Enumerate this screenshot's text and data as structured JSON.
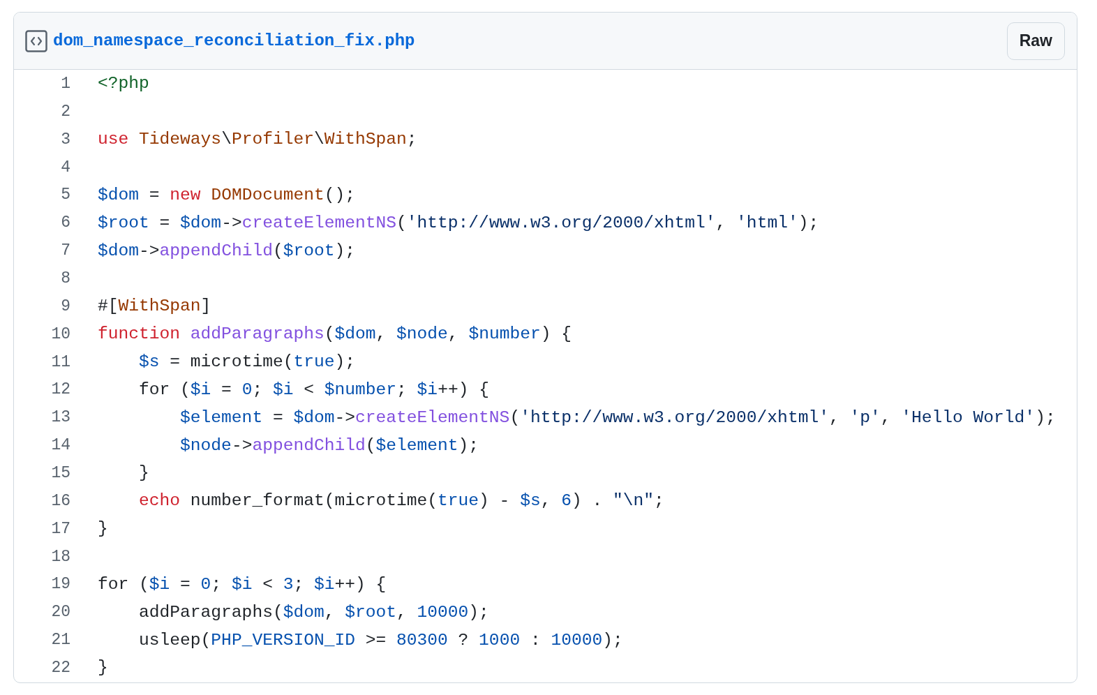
{
  "file": {
    "name": "dom_namespace_reconciliation_fix.php",
    "raw_button": "Raw"
  },
  "lines": [
    {
      "number": "1",
      "tokens": [
        {
          "kind": "meta",
          "text": "<?php"
        }
      ]
    },
    {
      "number": "2"
    },
    {
      "number": "3",
      "tokens": [
        {
          "kind": "keyword",
          "text": "use "
        },
        {
          "kind": "entity",
          "text": "Tideways"
        },
        {
          "kind": "plain",
          "text": "\\"
        },
        {
          "kind": "entity",
          "text": "Profiler"
        },
        {
          "kind": "plain",
          "text": "\\"
        },
        {
          "kind": "entity",
          "text": "WithSpan"
        },
        {
          "kind": "plain",
          "text": ";"
        }
      ]
    },
    {
      "number": "4"
    },
    {
      "number": "5",
      "tokens": [
        {
          "kind": "variable",
          "text": "$dom"
        },
        {
          "kind": "plain",
          "text": " = "
        },
        {
          "kind": "keyword",
          "text": "new "
        },
        {
          "kind": "entity",
          "text": "DOMDocument"
        },
        {
          "kind": "plain",
          "text": "();"
        }
      ]
    },
    {
      "number": "6",
      "tokens": [
        {
          "kind": "variable",
          "text": "$root"
        },
        {
          "kind": "plain",
          "text": " = "
        },
        {
          "kind": "variable",
          "text": "$dom"
        },
        {
          "kind": "plain",
          "text": "->"
        },
        {
          "kind": "function",
          "text": "createElementNS"
        },
        {
          "kind": "plain",
          "text": "("
        },
        {
          "kind": "string",
          "text": "'http://www.w3.org/2000/xhtml'"
        },
        {
          "kind": "plain",
          "text": ", "
        },
        {
          "kind": "string",
          "text": "'html'"
        },
        {
          "kind": "plain",
          "text": ");"
        }
      ]
    },
    {
      "number": "7",
      "tokens": [
        {
          "kind": "variable",
          "text": "$dom"
        },
        {
          "kind": "plain",
          "text": "->"
        },
        {
          "kind": "function",
          "text": "appendChild"
        },
        {
          "kind": "plain",
          "text": "("
        },
        {
          "kind": "variable",
          "text": "$root"
        },
        {
          "kind": "plain",
          "text": ");"
        }
      ]
    },
    {
      "number": "8"
    },
    {
      "number": "9",
      "tokens": [
        {
          "kind": "plain",
          "text": "#["
        },
        {
          "kind": "entity",
          "text": "WithSpan"
        },
        {
          "kind": "plain",
          "text": "]"
        }
      ]
    },
    {
      "number": "10",
      "tokens": [
        {
          "kind": "keyword",
          "text": "function "
        },
        {
          "kind": "function",
          "text": "addParagraphs"
        },
        {
          "kind": "plain",
          "text": "("
        },
        {
          "kind": "variable",
          "text": "$dom"
        },
        {
          "kind": "plain",
          "text": ", "
        },
        {
          "kind": "variable",
          "text": "$node"
        },
        {
          "kind": "plain",
          "text": ", "
        },
        {
          "kind": "variable",
          "text": "$number"
        },
        {
          "kind": "plain",
          "text": ") {"
        }
      ]
    },
    {
      "number": "11",
      "tokens": [
        {
          "kind": "variable",
          "text": "    $s"
        },
        {
          "kind": "plain",
          "text": " = microtime("
        },
        {
          "kind": "constant",
          "text": "true"
        },
        {
          "kind": "plain",
          "text": ");"
        }
      ]
    },
    {
      "number": "12",
      "tokens": [
        {
          "kind": "plain",
          "text": "    for ("
        },
        {
          "kind": "variable",
          "text": "$i"
        },
        {
          "kind": "plain",
          "text": " = "
        },
        {
          "kind": "constant",
          "text": "0"
        },
        {
          "kind": "plain",
          "text": "; "
        },
        {
          "kind": "variable",
          "text": "$i"
        },
        {
          "kind": "plain",
          "text": " < "
        },
        {
          "kind": "variable",
          "text": "$number"
        },
        {
          "kind": "plain",
          "text": "; "
        },
        {
          "kind": "variable",
          "text": "$i"
        },
        {
          "kind": "plain",
          "text": "++) {"
        }
      ]
    },
    {
      "number": "13",
      "tokens": [
        {
          "kind": "variable",
          "text": "        $element"
        },
        {
          "kind": "plain",
          "text": " = "
        },
        {
          "kind": "variable",
          "text": "$dom"
        },
        {
          "kind": "plain",
          "text": "->"
        },
        {
          "kind": "function",
          "text": "createElementNS"
        },
        {
          "kind": "plain",
          "text": "("
        },
        {
          "kind": "string",
          "text": "'http://www.w3.org/2000/xhtml'"
        },
        {
          "kind": "plain",
          "text": ", "
        },
        {
          "kind": "string",
          "text": "'p'"
        },
        {
          "kind": "plain",
          "text": ", "
        },
        {
          "kind": "string",
          "text": "'Hello World'"
        },
        {
          "kind": "plain",
          "text": ");"
        }
      ]
    },
    {
      "number": "14",
      "tokens": [
        {
          "kind": "variable",
          "text": "        $node"
        },
        {
          "kind": "plain",
          "text": "->"
        },
        {
          "kind": "function",
          "text": "appendChild"
        },
        {
          "kind": "plain",
          "text": "("
        },
        {
          "kind": "variable",
          "text": "$element"
        },
        {
          "kind": "plain",
          "text": ");"
        }
      ]
    },
    {
      "number": "15",
      "tokens": [
        {
          "kind": "plain",
          "text": "    }"
        }
      ]
    },
    {
      "number": "16",
      "tokens": [
        {
          "kind": "keyword",
          "text": "    echo"
        },
        {
          "kind": "plain",
          "text": " number_format(microtime("
        },
        {
          "kind": "constant",
          "text": "true"
        },
        {
          "kind": "plain",
          "text": ") - "
        },
        {
          "kind": "variable",
          "text": "$s"
        },
        {
          "kind": "plain",
          "text": ", "
        },
        {
          "kind": "constant",
          "text": "6"
        },
        {
          "kind": "plain",
          "text": ") . "
        },
        {
          "kind": "string",
          "text": "\"\\n\""
        },
        {
          "kind": "plain",
          "text": ";"
        }
      ]
    },
    {
      "number": "17",
      "tokens": [
        {
          "kind": "plain",
          "text": "}"
        }
      ]
    },
    {
      "number": "18"
    },
    {
      "number": "19",
      "tokens": [
        {
          "kind": "plain",
          "text": "for ("
        },
        {
          "kind": "variable",
          "text": "$i"
        },
        {
          "kind": "plain",
          "text": " = "
        },
        {
          "kind": "constant",
          "text": "0"
        },
        {
          "kind": "plain",
          "text": "; "
        },
        {
          "kind": "variable",
          "text": "$i"
        },
        {
          "kind": "plain",
          "text": " < "
        },
        {
          "kind": "constant",
          "text": "3"
        },
        {
          "kind": "plain",
          "text": "; "
        },
        {
          "kind": "variable",
          "text": "$i"
        },
        {
          "kind": "plain",
          "text": "++) {"
        }
      ]
    },
    {
      "number": "20",
      "tokens": [
        {
          "kind": "plain",
          "text": "    addParagraphs("
        },
        {
          "kind": "variable",
          "text": "$dom"
        },
        {
          "kind": "plain",
          "text": ", "
        },
        {
          "kind": "variable",
          "text": "$root"
        },
        {
          "kind": "plain",
          "text": ", "
        },
        {
          "kind": "constant",
          "text": "10000"
        },
        {
          "kind": "plain",
          "text": ");"
        }
      ]
    },
    {
      "number": "21",
      "tokens": [
        {
          "kind": "plain",
          "text": "    usleep("
        },
        {
          "kind": "constant",
          "text": "PHP_VERSION_ID"
        },
        {
          "kind": "plain",
          "text": " >= "
        },
        {
          "kind": "constant",
          "text": "80300"
        },
        {
          "kind": "plain",
          "text": " ? "
        },
        {
          "kind": "constant",
          "text": "1000"
        },
        {
          "kind": "plain",
          "text": " : "
        },
        {
          "kind": "constant",
          "text": "10000"
        },
        {
          "kind": "plain",
          "text": ");"
        }
      ]
    },
    {
      "number": "22",
      "tokens": [
        {
          "kind": "plain",
          "text": "}"
        }
      ]
    }
  ]
}
